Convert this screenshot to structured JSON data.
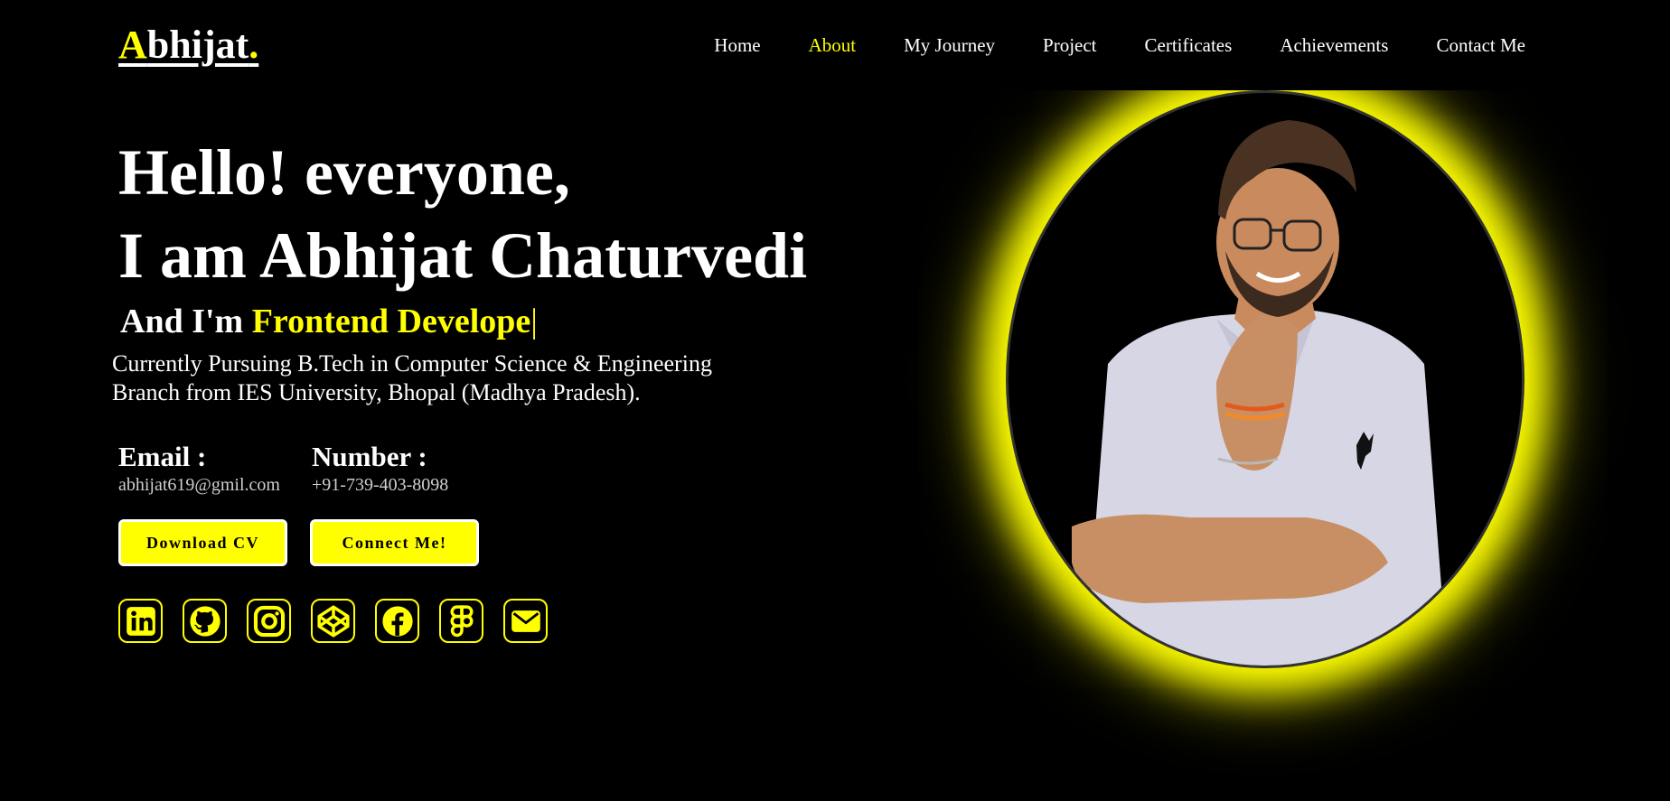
{
  "logo": {
    "first": "A",
    "rest": "bhijat",
    "dot": "."
  },
  "nav": [
    {
      "label": "Home",
      "active": false
    },
    {
      "label": "About",
      "active": true
    },
    {
      "label": "My Journey",
      "active": false
    },
    {
      "label": "Project",
      "active": false
    },
    {
      "label": "Certificates",
      "active": false
    },
    {
      "label": "Achievements",
      "active": false
    },
    {
      "label": "Contact Me",
      "active": false
    }
  ],
  "hero": {
    "line1": "Hello! everyone,",
    "line2": "I am Abhijat Chaturvedi",
    "role_prefix": "And I'm ",
    "role_typed": "Frontend Develope",
    "caret": "|",
    "desc_line1": "Currently Pursuing B.Tech in Computer Science & Engineering",
    "desc_line2": "Branch from IES University, Bhopal (Madhya Pradesh)."
  },
  "contact": {
    "email_title": "Email :",
    "email_value": "abhijat619@gmil.com",
    "number_title": "Number :",
    "number_value": "+91-739-403-8098"
  },
  "buttons": {
    "cv": "Download CV",
    "connect": "Connect Me!"
  },
  "socials": [
    "linkedin-icon",
    "github-icon",
    "instagram-icon",
    "codepen-icon",
    "facebook-icon",
    "figma-icon",
    "mail-icon"
  ],
  "colors": {
    "accent": "#ffff00",
    "background": "#000000",
    "text": "#ffffff",
    "muted": "#cfcfcf"
  }
}
